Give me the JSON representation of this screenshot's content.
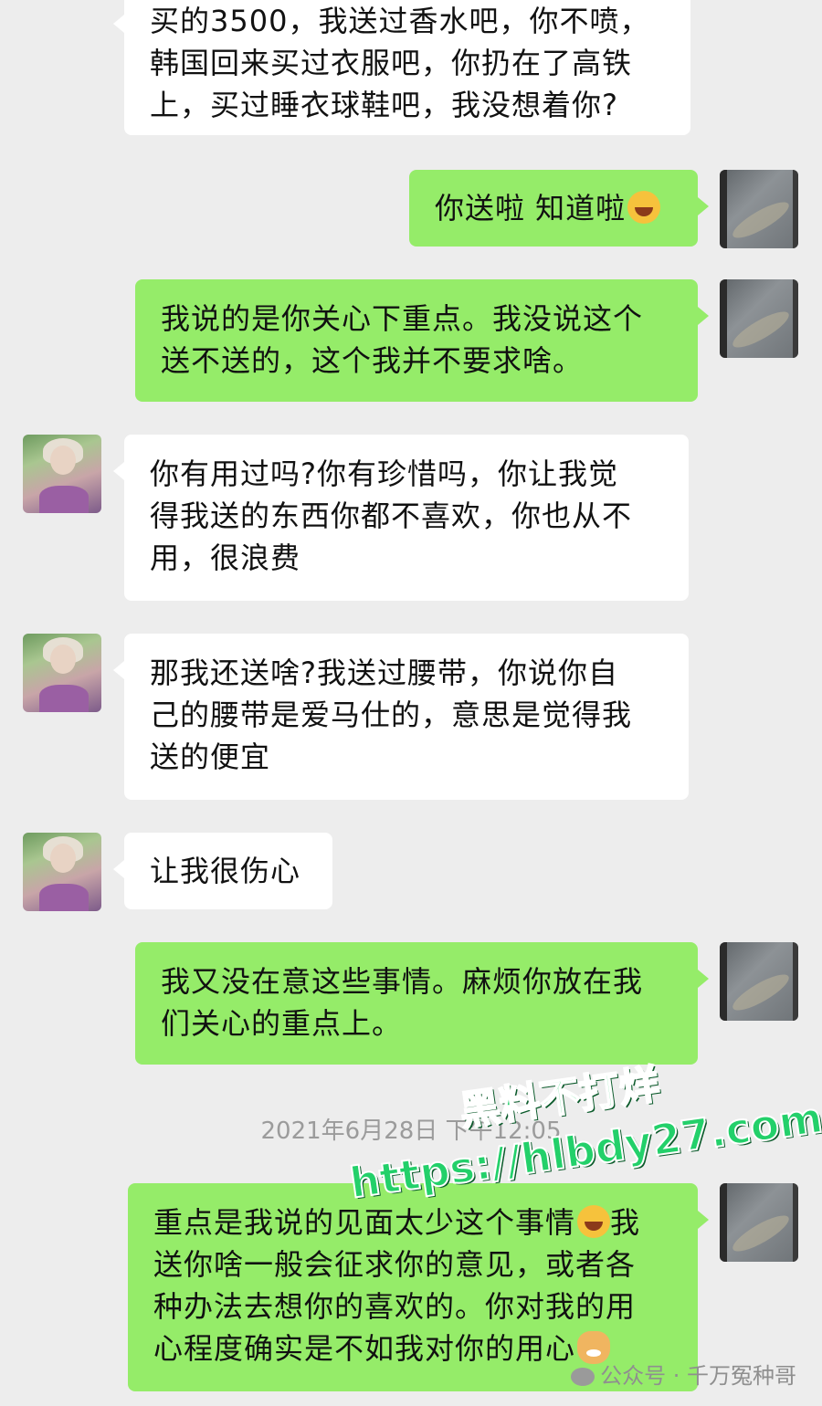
{
  "messages": [
    {
      "id": "m1",
      "side": "left",
      "lines": [
        "买的3500，我送过香水吧，你不喷，",
        "韩国回来买过衣服吧，你扔在了高铁",
        "上，买过睡衣球鞋吧，我没想着你?"
      ]
    },
    {
      "id": "m2",
      "side": "right",
      "lines": [
        "你送啦 知道啦"
      ],
      "emoji": "laughing-tears-emoji"
    },
    {
      "id": "m3",
      "side": "right",
      "lines": [
        "我说的是你关心下重点。我没说这个",
        "送不送的，这个我并不要求啥。"
      ]
    },
    {
      "id": "m4",
      "side": "left",
      "lines": [
        "你有用过吗?你有珍惜吗，你让我觉",
        "得我送的东西你都不喜欢，你也从不",
        "用，很浪费"
      ]
    },
    {
      "id": "m5",
      "side": "left",
      "lines": [
        "那我还送啥?我送过腰带，你说你自",
        "己的腰带是爱马仕的，意思是觉得我",
        "送的便宜"
      ]
    },
    {
      "id": "m6",
      "side": "left",
      "lines": [
        "让我很伤心"
      ]
    },
    {
      "id": "m7",
      "side": "right",
      "lines": [
        "我又没在意这些事情。麻烦你放在我",
        "们关心的重点上。"
      ]
    },
    {
      "id": "m8",
      "side": "right",
      "lines": [
        "重点是我说的见面太少这个事情",
        "送你啥一般会征求你的意见，或者各",
        "种办法去想你的喜欢的。你对我的用",
        "心程度确实是不如我对你的用心"
      ],
      "line1_tail": "我",
      "emoji_line1": "crying-emoji",
      "emoji_last": "dog-emoji"
    }
  ],
  "timestamp": "2021年6月28日 下午12:05",
  "watermark": {
    "line1": "黑料不打烊",
    "line2": "https://hlbdy27.com"
  },
  "source": {
    "label": "公众号 · 千万冤种哥",
    "icon": "wechat-icon"
  },
  "colors": {
    "background": "#ededed",
    "bubble_incoming": "#ffffff",
    "bubble_outgoing": "#95ec69",
    "timestamp": "#9b9b9b",
    "watermark": "#23d06a"
  }
}
